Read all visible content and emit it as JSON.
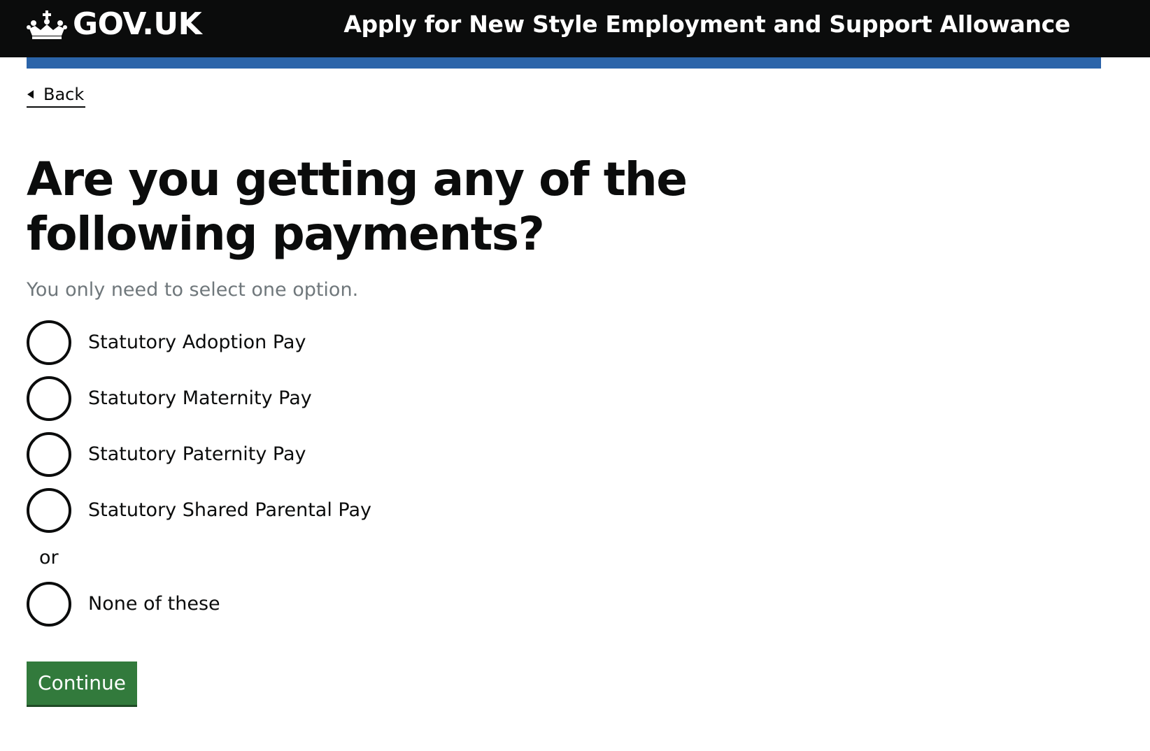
{
  "header": {
    "logo_text": "GOV.UK",
    "service_name": "Apply for New Style Employment and Support Allowance",
    "background_color": "#0b0c0c",
    "accent_bar_color": "#2b64a9"
  },
  "back_link": {
    "label": "Back"
  },
  "question": {
    "heading": "Are you getting any of the following payments?",
    "hint": "You only need to select one option.",
    "options": [
      {
        "label": "Statutory Adoption Pay",
        "selected": false
      },
      {
        "label": "Statutory Maternity Pay",
        "selected": false
      },
      {
        "label": "Statutory Paternity Pay",
        "selected": false
      },
      {
        "label": "Statutory Shared Parental Pay",
        "selected": false
      }
    ],
    "divider": "or",
    "none_option": {
      "label": "None of these",
      "selected": false
    }
  },
  "actions": {
    "continue_label": "Continue",
    "button_color": "#327a3c"
  }
}
